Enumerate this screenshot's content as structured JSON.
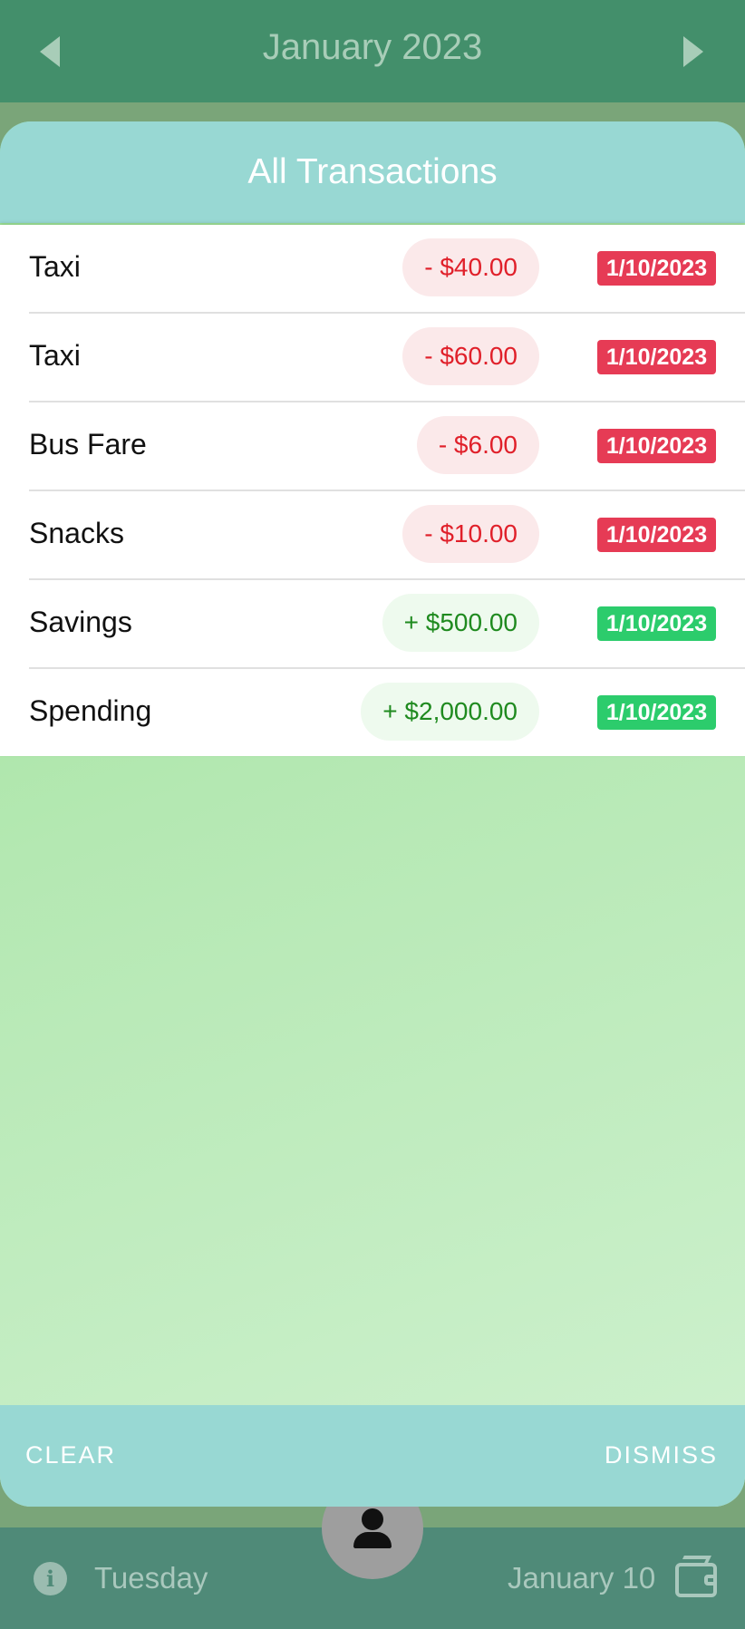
{
  "header": {
    "month": "January 2023"
  },
  "modal": {
    "title": "All Transactions",
    "transactions": [
      {
        "name": "Taxi",
        "amount": "- $40.00",
        "date": "1/10/2023",
        "type": "neg"
      },
      {
        "name": "Taxi",
        "amount": "- $60.00",
        "date": "1/10/2023",
        "type": "neg"
      },
      {
        "name": "Bus Fare",
        "amount": "- $6.00",
        "date": "1/10/2023",
        "type": "neg"
      },
      {
        "name": "Snacks",
        "amount": "- $10.00",
        "date": "1/10/2023",
        "type": "neg"
      },
      {
        "name": "Savings",
        "amount": "+ $500.00",
        "date": "1/10/2023",
        "type": "pos"
      },
      {
        "name": "Spending",
        "amount": "+ $2,000.00",
        "date": "1/10/2023",
        "type": "pos"
      }
    ],
    "clear_label": "CLEAR",
    "dismiss_label": "DISMISS"
  },
  "bottom_bar": {
    "day": "Tuesday",
    "date": "January 10"
  },
  "colors": {
    "header_bg": "#438f6b",
    "modal_header": "#98d8d3",
    "expense_badge": "#e63b55",
    "income_badge": "#2ccc6c"
  },
  "icons": {
    "prev": "chevron-left-icon",
    "next": "chevron-right-icon",
    "info": "info-icon",
    "wallet": "wallet-icon",
    "profile": "person-icon"
  }
}
